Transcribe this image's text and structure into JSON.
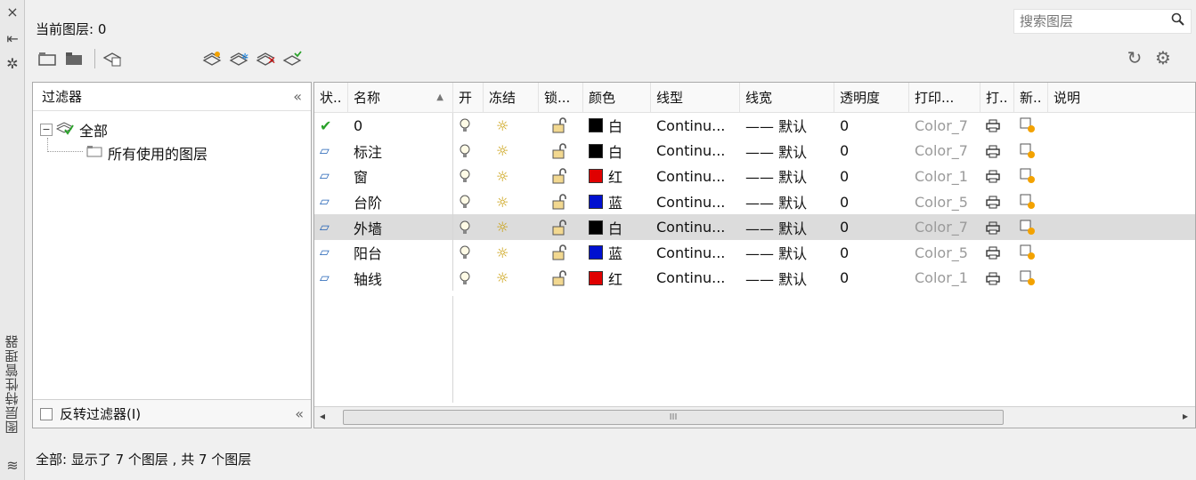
{
  "left_strip": {
    "close_icon": "×",
    "pin_icon": "⇤",
    "settings_icon": "✲",
    "title": "图层特性管理器",
    "layers_icon": "≋"
  },
  "header": {
    "current_layer_label": "当前图层: 0",
    "search_placeholder": "搜索图层",
    "search_icon": "🔍"
  },
  "toolbar": {
    "left": [
      "new-property-filter-icon",
      "new-group-filter-icon",
      "layer-states-icon"
    ],
    "layer_actions": [
      "new-layer-icon",
      "new-layer-vp-frozen-icon",
      "delete-layer-icon",
      "set-current-icon"
    ],
    "refresh_icon": "↻",
    "settings_icon": "⚙"
  },
  "filter_panel": {
    "title": "过滤器",
    "collapse": "«",
    "tree": [
      {
        "label": "全部",
        "expander": "⊟",
        "icon": "✔"
      },
      {
        "label": "所有使用的图层",
        "icon": "▭"
      }
    ],
    "invert_label": "反转过滤器(I)"
  },
  "grid": {
    "columns": [
      "状..",
      "名称",
      "开",
      "冻结",
      "锁...",
      "颜色",
      "线型",
      "线宽",
      "透明度",
      "打印...",
      "打..",
      "新..",
      "说明"
    ],
    "rows": [
      {
        "status": "✔",
        "name": "0",
        "on": "💡",
        "freeze": "☼",
        "lock": "🔓",
        "color_hex": "#000000",
        "color": "白",
        "linetype": "Continu...",
        "lineweight": "—— 默认",
        "transparency": "0",
        "plot_style": "Color_7",
        "plot": "🖶",
        "new_vp": "⧉"
      },
      {
        "status": "▱",
        "name": "标注",
        "on": "💡",
        "freeze": "☼",
        "lock": "🔓",
        "color_hex": "#000000",
        "color": "白",
        "linetype": "Continu...",
        "lineweight": "—— 默认",
        "transparency": "0",
        "plot_style": "Color_7",
        "plot": "🖶",
        "new_vp": "⧉"
      },
      {
        "status": "▱",
        "name": "窗",
        "on": "💡",
        "freeze": "☼",
        "lock": "🔓",
        "color_hex": "#e00000",
        "color": "红",
        "linetype": "Continu...",
        "lineweight": "—— 默认",
        "transparency": "0",
        "plot_style": "Color_1",
        "plot": "🖶",
        "new_vp": "⧉"
      },
      {
        "status": "▱",
        "name": "台阶",
        "on": "💡",
        "freeze": "☼",
        "lock": "🔓",
        "color_hex": "#0010d0",
        "color": "蓝",
        "linetype": "Continu...",
        "lineweight": "—— 默认",
        "transparency": "0",
        "plot_style": "Color_5",
        "plot": "🖶",
        "new_vp": "⧉"
      },
      {
        "status": "▱",
        "name": "外墙",
        "on": "💡",
        "freeze": "☼",
        "lock": "🔓",
        "color_hex": "#000000",
        "color": "白",
        "linetype": "Continu...",
        "lineweight": "—— 默认",
        "transparency": "0",
        "plot_style": "Color_7",
        "plot": "🖶",
        "new_vp": "⧉",
        "selected": true
      },
      {
        "status": "▱",
        "name": "阳台",
        "on": "💡",
        "freeze": "☼",
        "lock": "🔓",
        "color_hex": "#0010d0",
        "color": "蓝",
        "linetype": "Continu...",
        "lineweight": "—— 默认",
        "transparency": "0",
        "plot_style": "Color_5",
        "plot": "🖶",
        "new_vp": "⧉"
      },
      {
        "status": "▱",
        "name": "轴线",
        "on": "💡",
        "freeze": "☼",
        "lock": "🔓",
        "color_hex": "#e00000",
        "color": "红",
        "linetype": "Continu...",
        "lineweight": "—— 默认",
        "transparency": "0",
        "plot_style": "Color_1",
        "plot": "🖶",
        "new_vp": "⧉"
      }
    ],
    "scroll": {
      "left": "◂",
      "right": "▸",
      "grip": "III"
    }
  },
  "status_bar": "全部: 显示了 7 个图层 , 共 7 个图层"
}
